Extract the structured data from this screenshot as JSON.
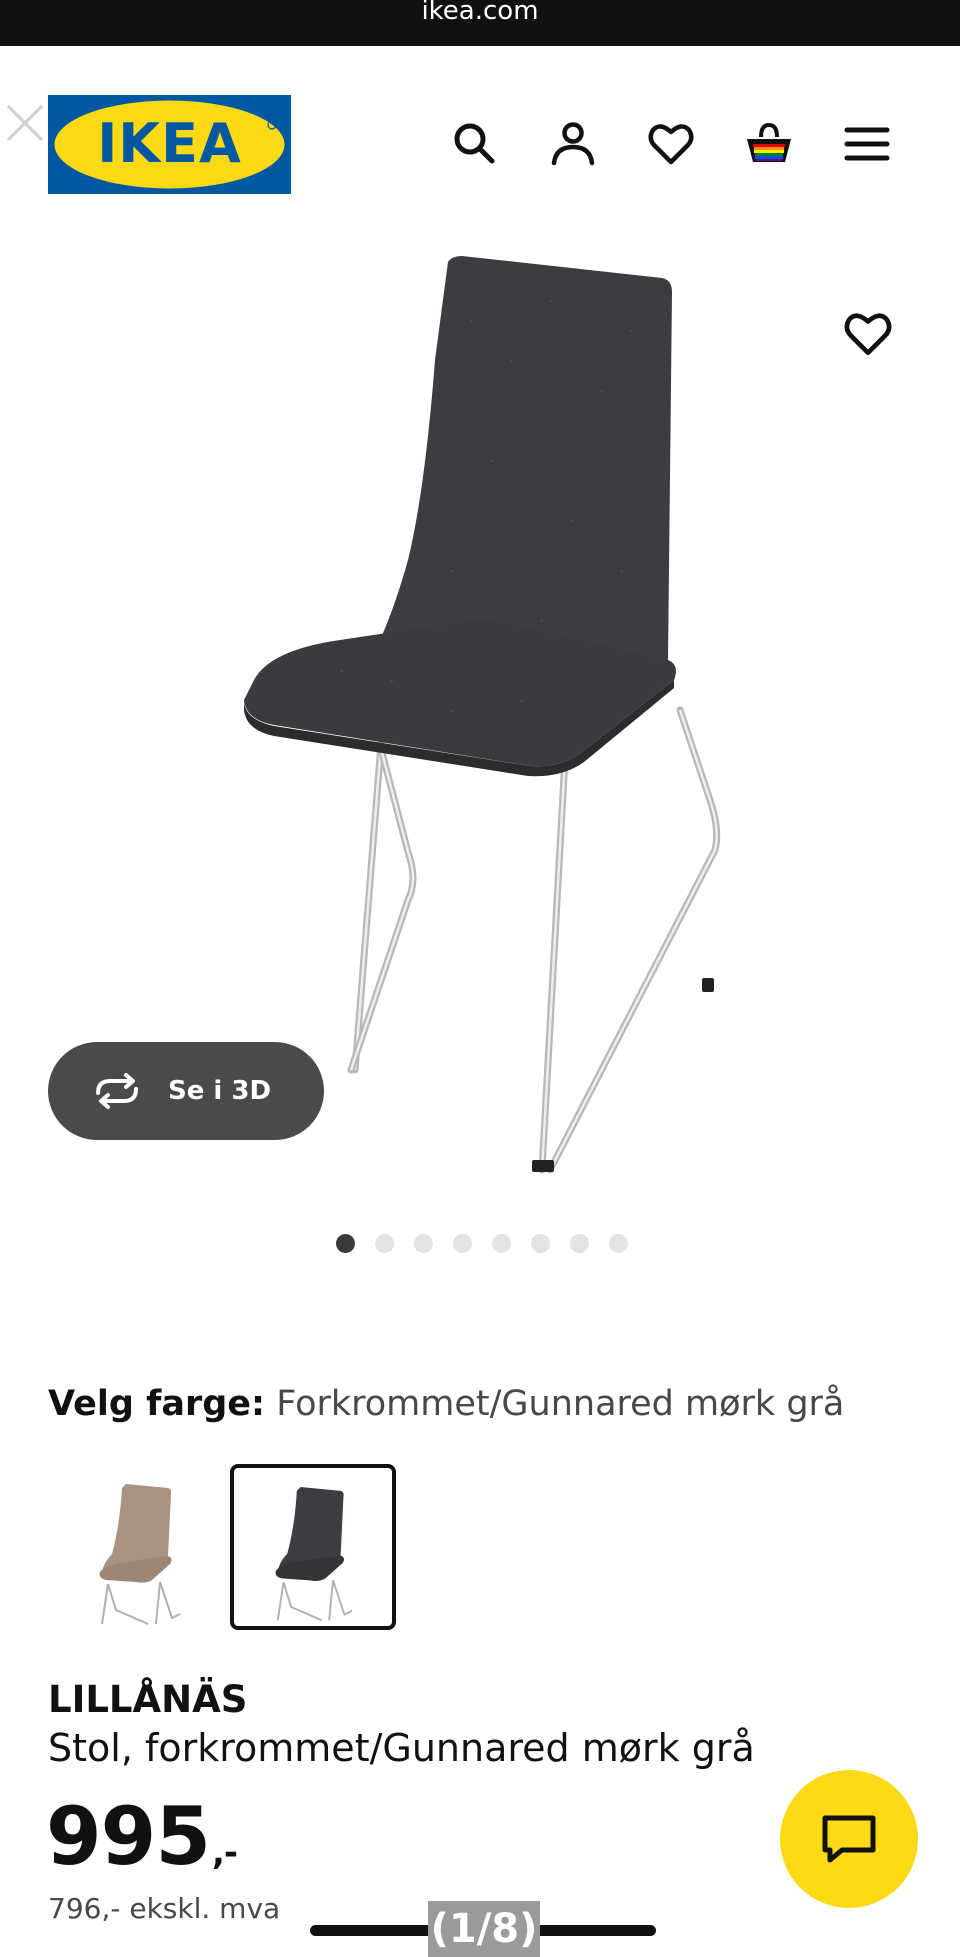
{
  "browser": {
    "url": "ikea.com"
  },
  "header": {
    "logo_text": "IKEA",
    "icons": [
      "close-icon",
      "search-icon",
      "account-icon",
      "heart-icon",
      "cart-icon",
      "menu-icon"
    ]
  },
  "gallery": {
    "view_3d_label": "Se i 3D",
    "dots_total": 8,
    "active_dot": 1,
    "counter": "(1/8)"
  },
  "color_select": {
    "label": "Velg farge:",
    "selected": "Forkrommet/Gunnared mørk grå"
  },
  "product": {
    "name": "LILLÅNÄS",
    "description": "Stol, forkrommet/Gunnared mørk grå",
    "price": "995",
    "price_suffix": ",-",
    "price_ex_vat": "796,- ekskl. mva"
  },
  "colors": {
    "ikea_blue": "#0058a3",
    "ikea_yellow": "#fbd914",
    "fabric_dark": "#3c3d40",
    "fabric_beige": "#a89382"
  }
}
